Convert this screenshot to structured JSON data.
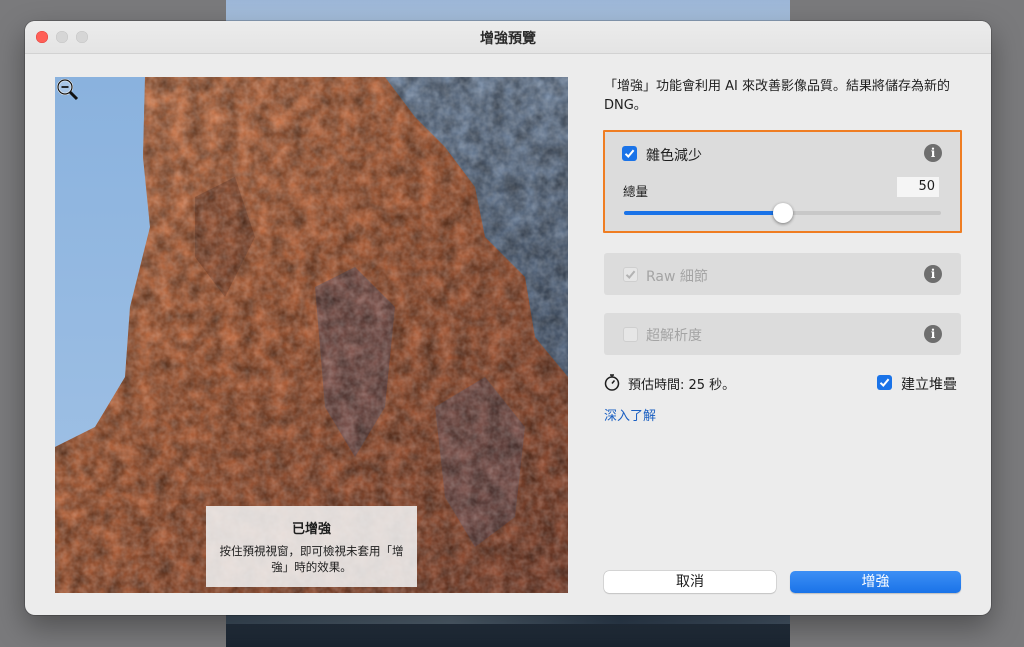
{
  "window": {
    "title": "增強預覽"
  },
  "preview": {
    "overlay_title": "已增強",
    "overlay_text": "按住預視視窗，即可檢視未套用「增強」時的效果。",
    "zoom_icon": "zoom-out-magnifier-icon"
  },
  "panel": {
    "description": "「增強」功能會利用 AI 來改善影像品質。結果將儲存為新的 DNG。",
    "noise_reduction": {
      "label": "雜色減少",
      "checked": true,
      "amount_label": "總量",
      "amount_value": "50",
      "amount": 50,
      "max": 100
    },
    "raw_details": {
      "label": "Raw 細節",
      "checked": true,
      "disabled": true
    },
    "super_resolution": {
      "label": "超解析度",
      "checked": false,
      "disabled": true
    },
    "estimate": "預估時間: 25 秒。",
    "create_stack": {
      "label": "建立堆疊",
      "checked": true
    },
    "learn_more": "深入了解"
  },
  "buttons": {
    "cancel": "取消",
    "enhance": "增強"
  },
  "colors": {
    "accent": "#1a73e8",
    "highlight": "#ef7d22",
    "close": "#ff5f57"
  }
}
